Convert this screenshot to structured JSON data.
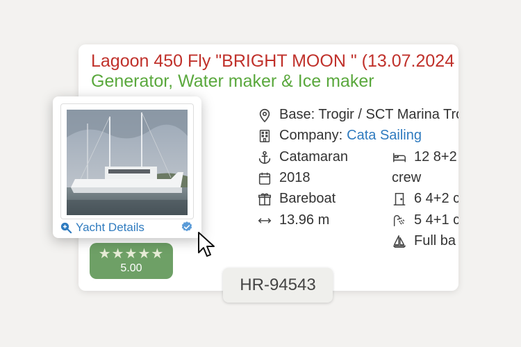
{
  "listing": {
    "title": "Lagoon 450 Fly \"BRIGHT MOON \" (13.07.2024",
    "subtitle": "Generator, Water maker & Ice maker"
  },
  "specs": {
    "base": "Base: Trogir / SCT Marina Tro",
    "company_label": "Company:",
    "company_name": "Cata Sailing",
    "type": "Catamaran",
    "berths": "12 8+2",
    "berths_extra": "crew",
    "year": "2018",
    "cabins": "6 4+2 c",
    "charter": "Bareboat",
    "heads": "5 4+1 c",
    "length": "13.96 m",
    "sail": "Full ba"
  },
  "rating": {
    "stars": "★★★★★",
    "score": "5.00"
  },
  "popup": {
    "details_label": "Yacht Details"
  },
  "badge": {
    "id": "HR-94543"
  }
}
